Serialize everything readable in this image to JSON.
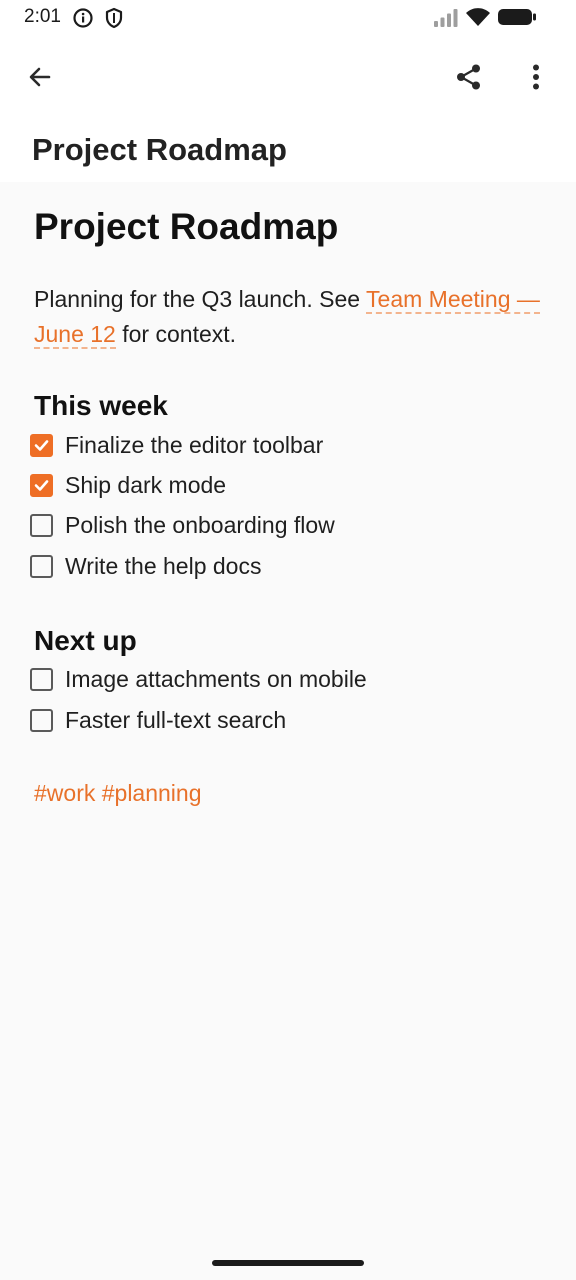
{
  "status_bar": {
    "time": "2:01",
    "icons": [
      "info-icon",
      "shield-icon",
      "signal-icon",
      "wifi-icon",
      "battery-icon"
    ]
  },
  "app_bar": {
    "back_icon": "arrow-left-icon",
    "share_icon": "share-icon",
    "more_icon": "more-vert-icon",
    "title": "Project Roadmap"
  },
  "note": {
    "heading": "Project Roadmap",
    "intro_before": "Planning for the Q3 launch. See ",
    "intro_link": "Team Meeting — June 12",
    "intro_after": " for context.",
    "sections": [
      {
        "title": "This week",
        "tasks": [
          {
            "label": "Finalize the editor toolbar",
            "checked": true
          },
          {
            "label": "Ship dark mode",
            "checked": true
          },
          {
            "label": "Polish the onboarding flow",
            "checked": false
          },
          {
            "label": "Write the help docs",
            "checked": false
          }
        ]
      },
      {
        "title": "Next up",
        "tasks": [
          {
            "label": "Image attachments on mobile",
            "checked": false
          },
          {
            "label": "Faster full-text search",
            "checked": false
          }
        ]
      }
    ],
    "tags": "#work #planning"
  },
  "colors": {
    "accent": "#ee6e25",
    "link": "#e8712a",
    "background": "#fafafa"
  }
}
